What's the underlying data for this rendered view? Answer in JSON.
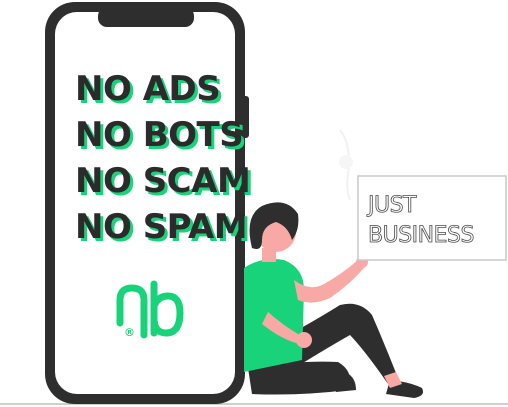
{
  "phone": {
    "lines": [
      "NO ADS",
      "NO BOTS",
      "NO SCAM",
      "NO SPAM"
    ]
  },
  "logo": {
    "mark": "ᑭb",
    "registered": "®",
    "color": "#19d37a"
  },
  "sign": {
    "lines": [
      "JUST",
      "BUSINESS"
    ]
  },
  "colors": {
    "accent_green": "#19d37a",
    "ink": "#2b2b2b",
    "skin": "#f8a9a6"
  }
}
